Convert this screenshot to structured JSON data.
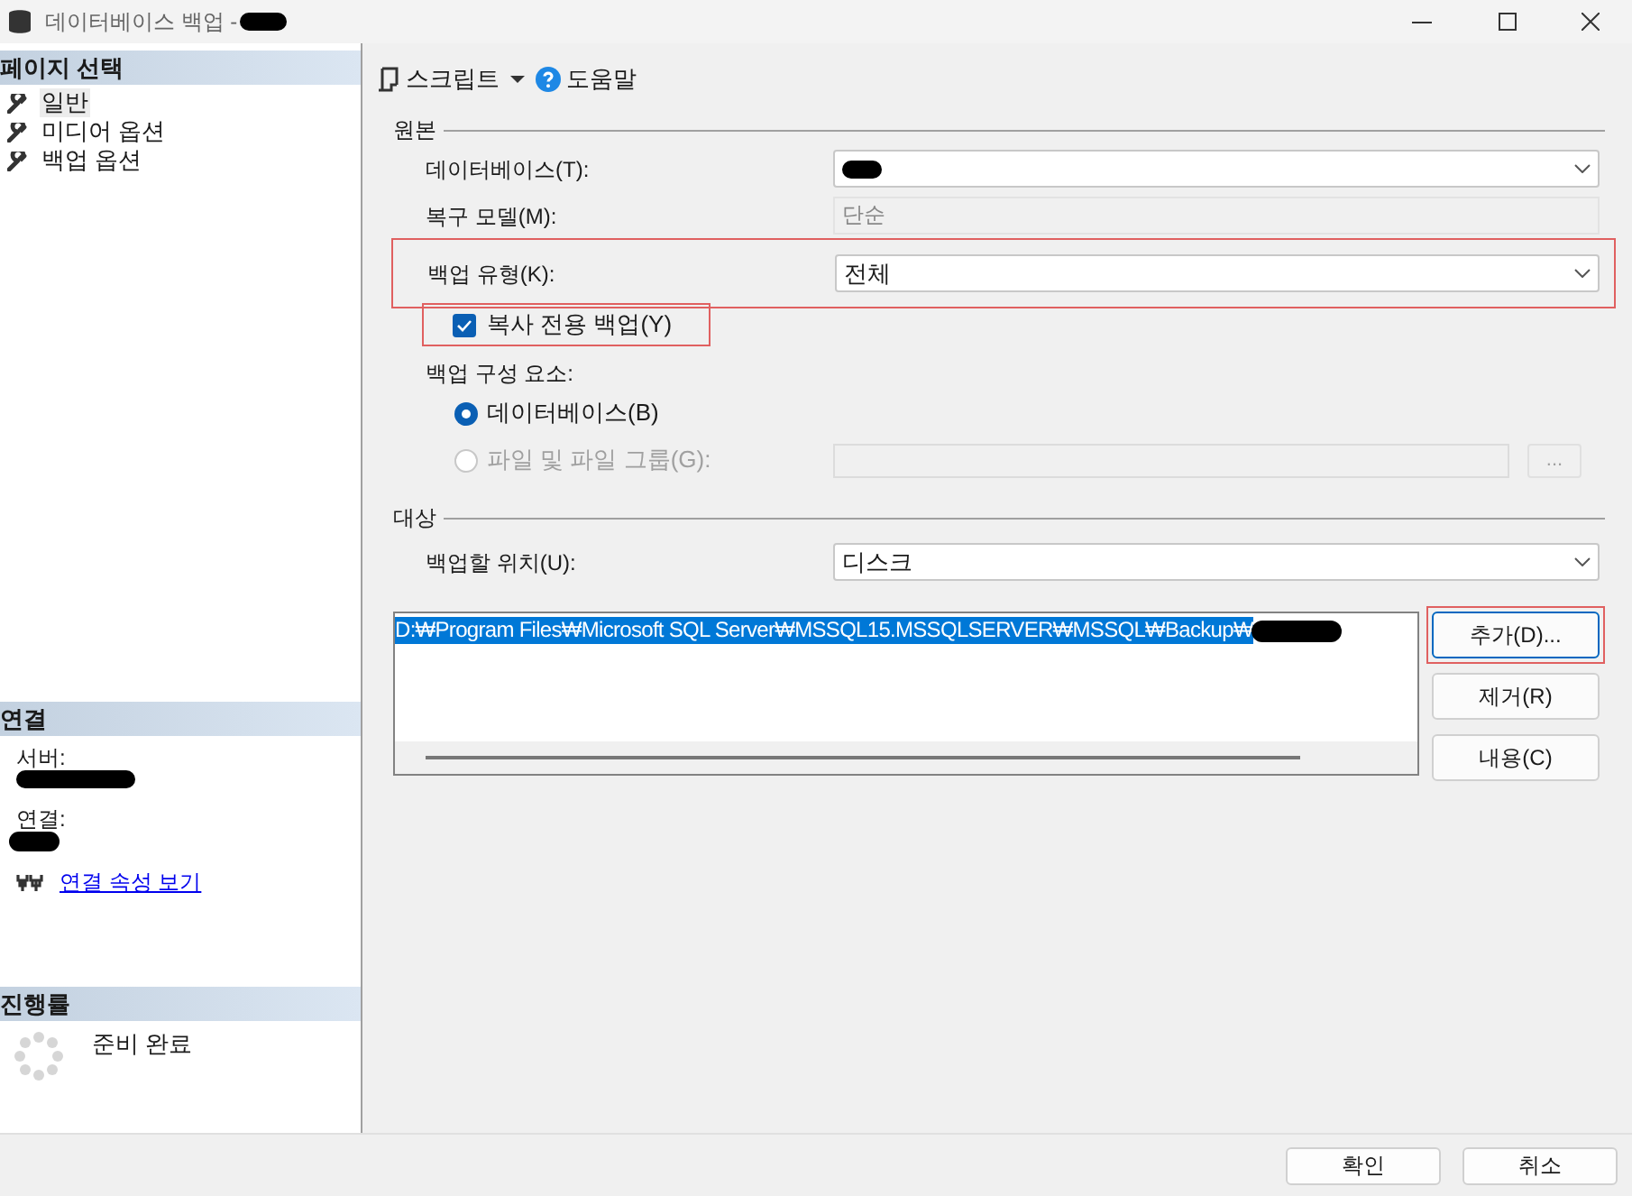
{
  "window": {
    "title": "데이터베이스 백업 -"
  },
  "page_select": {
    "title": "페이지 선택",
    "items": [
      {
        "label": "일반",
        "selected": true
      },
      {
        "label": "미디어 옵션",
        "selected": false
      },
      {
        "label": "백업 옵션",
        "selected": false
      }
    ]
  },
  "connection": {
    "title": "연결",
    "server_label": "서버:",
    "connection_label": "연결:",
    "link": "연결 속성 보기"
  },
  "progress": {
    "title": "진행률",
    "status": "준비 완료"
  },
  "toolbar": {
    "script": "스크립트",
    "help": "도움말"
  },
  "source": {
    "title": "원본",
    "database": {
      "label": "데이터베이스(T):"
    },
    "recovery_model": {
      "label": "복구 모델(M):",
      "value": "단순"
    },
    "backup_type": {
      "label": "백업 유형(K):",
      "value": "전체",
      "highlighted": true
    },
    "copy_only": {
      "label": "복사 전용 백업(Y)",
      "checked": true,
      "highlighted": true
    },
    "component_label": "백업 구성 요소:",
    "components": [
      {
        "label": "데이터베이스(B)",
        "selected": true,
        "disabled": false
      },
      {
        "label": "파일 및 파일 그룹(G):",
        "selected": false,
        "disabled": true,
        "browse": "..."
      }
    ]
  },
  "destination": {
    "title": "대상",
    "location": {
      "label": "백업할 위치(U):",
      "value": "디스크"
    },
    "paths": [
      {
        "text": "D:₩Program Files₩Microsoft SQL Server₩MSSQL15.MSSQLSERVER₩MSSQL₩Backup₩",
        "selected": true
      }
    ],
    "buttons": [
      {
        "label": "추가(D)...",
        "highlighted": true
      },
      {
        "label": "제거(R)",
        "highlighted": false
      },
      {
        "label": "내용(C)",
        "highlighted": false
      }
    ]
  },
  "footer_buttons": [
    "확인",
    "취소"
  ]
}
